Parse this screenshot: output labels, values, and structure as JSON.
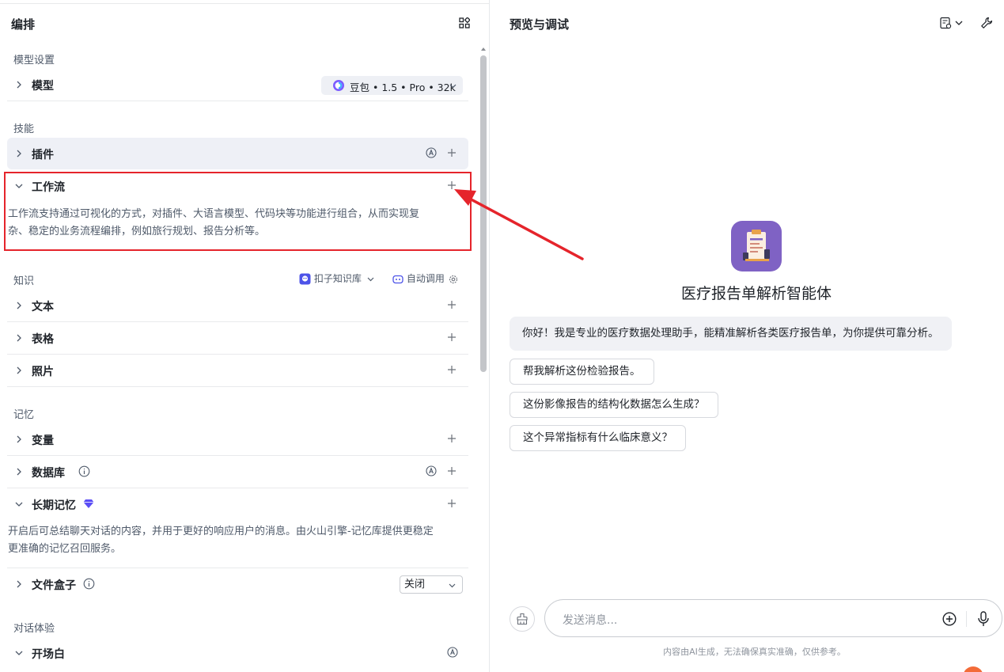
{
  "left": {
    "title": "编排",
    "sections": {
      "model": "模型设置",
      "skills": "技能",
      "knowledge": "知识",
      "memory": "记忆",
      "dialog": "对话体验"
    },
    "model_row": {
      "label": "模型",
      "model_name": "豆包 • 1.5 • Pro • 32k"
    },
    "plugin_row": {
      "label": "插件"
    },
    "workflow_row": {
      "label": "工作流",
      "description_line1": "工作流支持通过可视化的方式，对插件、大语言模型、代码块等功能进行组合，从而实现复",
      "description_line2": "杂、稳定的业务流程编排，例如旅行规划、报告分析等。"
    },
    "knowledge_tags": {
      "kb": "扣子知识库",
      "auto": "自动调用"
    },
    "text_row": {
      "label": "文本"
    },
    "table_row": {
      "label": "表格"
    },
    "photo_row": {
      "label": "照片"
    },
    "variable_row": {
      "label": "变量"
    },
    "database_row": {
      "label": "数据库"
    },
    "longmem_row": {
      "label": "长期记忆",
      "description_line1": "开启后可总结聊天对话的内容，并用于更好的响应用户的消息。由火山引擎-记忆库提供更稳定",
      "description_line2": "更准确的记忆召回服务。"
    },
    "filebox_row": {
      "label": "文件盒子",
      "value": "关闭"
    },
    "opening_row": {
      "label": "开场白"
    }
  },
  "right": {
    "title": "预览与调试",
    "bot_name": "医疗报告单解析智能体",
    "greeting": "你好！我是专业的医疗数据处理助手，能精准解析各类医疗报告单，为你提供可靠分析。",
    "suggestions": [
      "帮我解析这份检验报告。",
      "这份影像报告的结构化数据怎么生成？",
      "这个异常指标有什么临床意义？"
    ],
    "input_placeholder": "发送消息...",
    "disclaimer": "内容由AI生成，无法确保真实准确，仅供参考。"
  },
  "colors": {
    "highlight_box": "#e5242b",
    "avatar_bg": "#7f62c4",
    "premium_badge": "#5b4ef5"
  }
}
